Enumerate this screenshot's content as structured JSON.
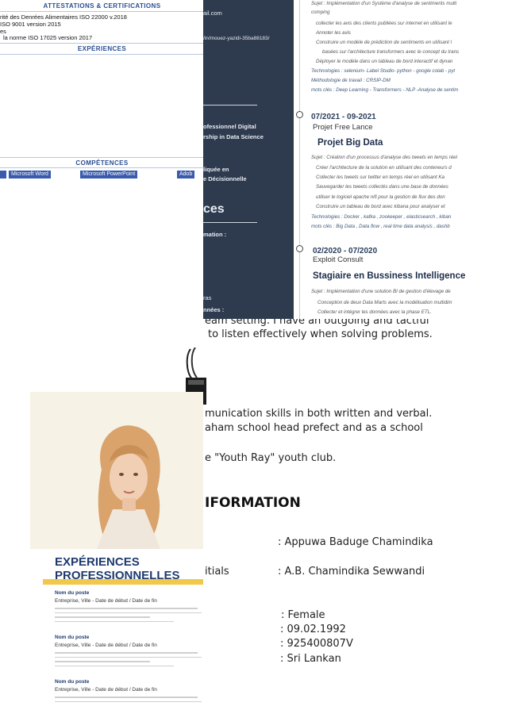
{
  "personal_info_cv": {
    "text_lines": [
      "eam setting. I have an outgoing and tactful",
      "to listen effectively when solving problems.",
      "munication skills in both written and verbal.",
      "aham school head prefect and as a school",
      "e \"Youth Ray\" youth club."
    ],
    "heading": "IFORMATION",
    "fields": [
      {
        "label": "",
        "value": ": Appuwa Baduge Chamindika"
      },
      {
        "label": "itials",
        "value": ": A.B. Chamindika Sewwandi"
      },
      {
        "label": "",
        "value": ": Female"
      },
      {
        "label": "",
        "value": ": 09.02.1992"
      },
      {
        "label": "",
        "value": ": 925400807V"
      },
      {
        "label": "",
        "value": ": Sri Lankan"
      }
    ]
  },
  "cert_cv": {
    "certifications_heading": "ATTESTATIONS & CERTIFICATIONS",
    "certifications": [
      "rité des Denrées Alimentaires ISO 22000 v.2018",
      "ISO 9001 version 2015",
      "es",
      "la norme ISO 17025 version 2017"
    ],
    "experiences_heading": "EXPÉRIENCES",
    "skills_heading": "COMPÉTENCES",
    "skills": [
      "",
      "Microsoft Word",
      "Microsoft PowerPoint",
      "Adob"
    ]
  },
  "sidebar": {
    "email_fragment": "ail.com",
    "linkedin_fragment": "/in/mouez-yazidi-35ba88183/",
    "training_lines": [
      "ofessionnel Digital",
      "rship in Data Science"
    ],
    "bi_lines": [
      "liquée en",
      "e Décisionnelle"
    ],
    "section_heading": "ces",
    "section_sub": "mation :",
    "footer_lines": [
      "ras",
      "nnées :"
    ]
  },
  "experience_cv": {
    "top": {
      "sujet": "Sujet : Implémentation d'un Système d'analyse de sentiments multi",
      "sujet_cont": "comping",
      "bullets": [
        "collecter les avis des clients publiées sur internet en utilisant le",
        "Annoter les avis",
        "Construire un modèle de prédiction de sentiments en utilisant l",
        "basées sur l'architecture transformers avec le concept du trans",
        "Déployer le modèle dans un tableau de bord interactif et dynan"
      ],
      "technologies": "Technologies : selenium- Label Studio- python - google colab - pyt",
      "methodologie": "Méthodologie de travail : CRSIP-DM",
      "mots_cles": "mots clés : Deep Learning - Transformers  - NLP -Analyse de sentim"
    },
    "jobs": [
      {
        "dates": "07/2021 - 09-2021",
        "organization": "Projet Free Lance",
        "title": "Projet Big Data",
        "sujet": "Sujet : Création d'un processus d'analyse des tweets en temps réel",
        "bullets": [
          "Créer l'architecture de la solution en utilisant des conteneurs d",
          "Collecter les tweets sur twitter en temps réel en utilisant Ka",
          "Sauvegarder les tweets collectés dans une base de données",
          "utiliser le logiciel  apache nifi pour la gestion de flux des don",
          "Construire un tableau de bord avec kibana pour analyser et"
        ],
        "technologies": "Technologies : Docker , kafka , zookeeper , elasticsearch , kiban",
        "mots_cles": "mots clés : Big Data , Data flow , real time data analysis , dashb"
      },
      {
        "dates": "02/2020 - 07/2020",
        "organization": "Exploit Consult",
        "title": "Stagiaire en  Bussiness Intelligence",
        "sujet": "Sujet : Implémentation d'une solution BI de gestion d'élevage de",
        "bullets": [
          "Conception de deux Data Marts avec la modélisation multidim",
          "Collecter et intégrer les données avec la phase ETL."
        ]
      }
    ]
  },
  "photo_cv": {
    "heading_line1": "EXPÉRIENCES",
    "heading_line2": "PROFESSIONNELLES",
    "entries": [
      {
        "job": "Nom du poste",
        "company": "Entreprise, Ville - Date de début / Date de fin"
      },
      {
        "job": "Nom du poste",
        "company": "Entreprise, Ville - Date de début / Date de fin"
      },
      {
        "job": "Nom du poste",
        "company": "Entreprise, Ville - Date de début / Date de fin"
      }
    ]
  },
  "colors": {
    "accent_blue": "#2a4e93",
    "sidebar_bg": "#2e3a4e",
    "heading_navy": "#1e3a6e",
    "highlight_yellow": "#f2c84b"
  }
}
